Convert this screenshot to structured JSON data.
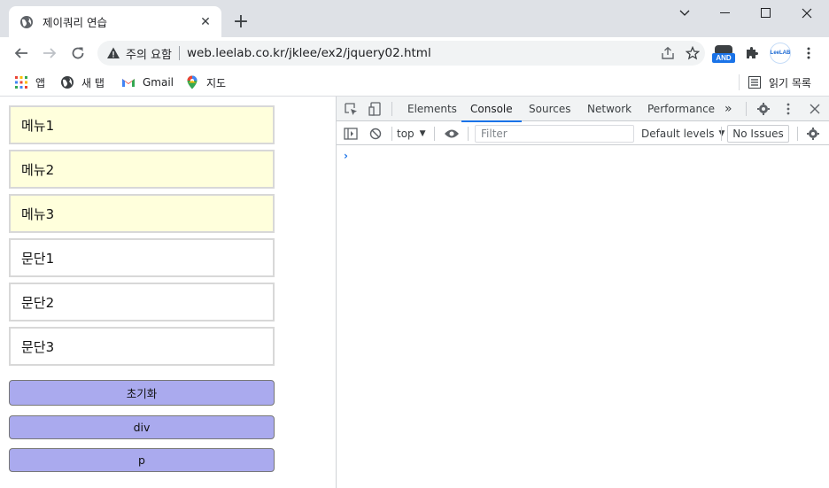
{
  "browser": {
    "tab": {
      "title": "제이쿼리 연습",
      "icon": "globe-icon"
    },
    "new_tab_icon": "plus-icon",
    "window_controls": [
      "chevron-down-icon",
      "minimize-icon",
      "maximize-icon",
      "close-icon"
    ],
    "address": {
      "security_label": "주의 요함",
      "url": "web.leelab.co.kr/jklee/ex2/jquery02.html"
    },
    "extensions": {
      "and_label": "AND",
      "leelab_label": "LeeLAB"
    },
    "bookmarks": [
      {
        "label": "앱",
        "icon": "apps-grid-icon"
      },
      {
        "label": "새 탭",
        "icon": "globe-icon"
      },
      {
        "label": "Gmail",
        "icon": "gmail-icon"
      },
      {
        "label": "지도",
        "icon": "maps-pin-icon"
      }
    ],
    "reading_list": "읽기 목록"
  },
  "page": {
    "menus": [
      "메뉴1",
      "메뉴2",
      "메뉴3"
    ],
    "paragraphs": [
      "문단1",
      "문단2",
      "문단3"
    ],
    "buttons": {
      "reset": "초기화",
      "div": "div",
      "p": "p"
    },
    "colors": {
      "menu_bg": "#ffffdc",
      "button_bg": "#aaaaee"
    }
  },
  "devtools": {
    "tabs": [
      "Elements",
      "Console",
      "Sources",
      "Network",
      "Performance"
    ],
    "active_tab": "Console",
    "more_tabs": "»",
    "context": "top",
    "filter_placeholder": "Filter",
    "levels": "Default levels",
    "issues": "No Issues",
    "prompt": "›"
  }
}
